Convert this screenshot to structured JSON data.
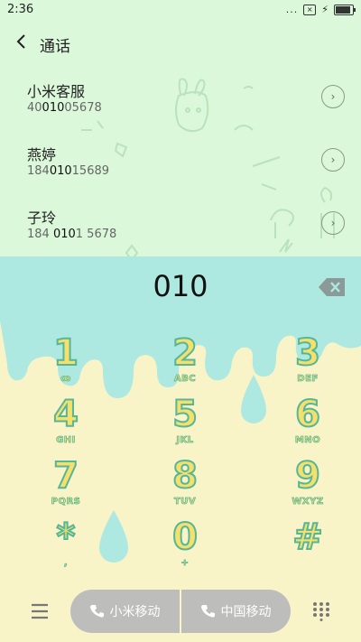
{
  "status_bar": {
    "time": "2:36",
    "dots": "...",
    "sim_label": "×"
  },
  "header": {
    "title": "通话",
    "back_icon": "chevron-left-icon"
  },
  "contacts": [
    {
      "name": "小米客服",
      "number_pre": "40",
      "number_match": "010",
      "number_post": "05678"
    },
    {
      "name": "燕婷",
      "number_pre": "184",
      "number_match": "010",
      "number_post": "15689"
    },
    {
      "name": "子玲",
      "number_pre": "184 ",
      "number_match": "010",
      "number_post": "1 5678"
    }
  ],
  "info_icon": "›",
  "dial": {
    "number": "010",
    "delete_icon": "backspace-icon"
  },
  "keys": [
    {
      "digit": "1",
      "letters": "ꝏ"
    },
    {
      "digit": "2",
      "letters": "ABC"
    },
    {
      "digit": "3",
      "letters": "DEF"
    },
    {
      "digit": "4",
      "letters": "GHI"
    },
    {
      "digit": "5",
      "letters": "JKL"
    },
    {
      "digit": "6",
      "letters": "MNO"
    },
    {
      "digit": "7",
      "letters": "PQRS"
    },
    {
      "digit": "8",
      "letters": "TUV"
    },
    {
      "digit": "9",
      "letters": "WXYZ"
    },
    {
      "digit": "*",
      "letters": ","
    },
    {
      "digit": "0",
      "letters": "+"
    },
    {
      "digit": "#",
      "letters": ""
    }
  ],
  "bottom": {
    "call_sim1": "小米移动",
    "call_sim2": "中国移动",
    "menu_icon": "menu-icon",
    "dialpad_icon": "dialpad-icon"
  },
  "colors": {
    "top_bg": "#dcf8da",
    "display_bg": "#aee9e1",
    "keypad_bg": "#f9f3c8",
    "digit_fill": "#f4e06a",
    "digit_stroke": "#56b69a",
    "call_button": "#bdbdbb"
  }
}
